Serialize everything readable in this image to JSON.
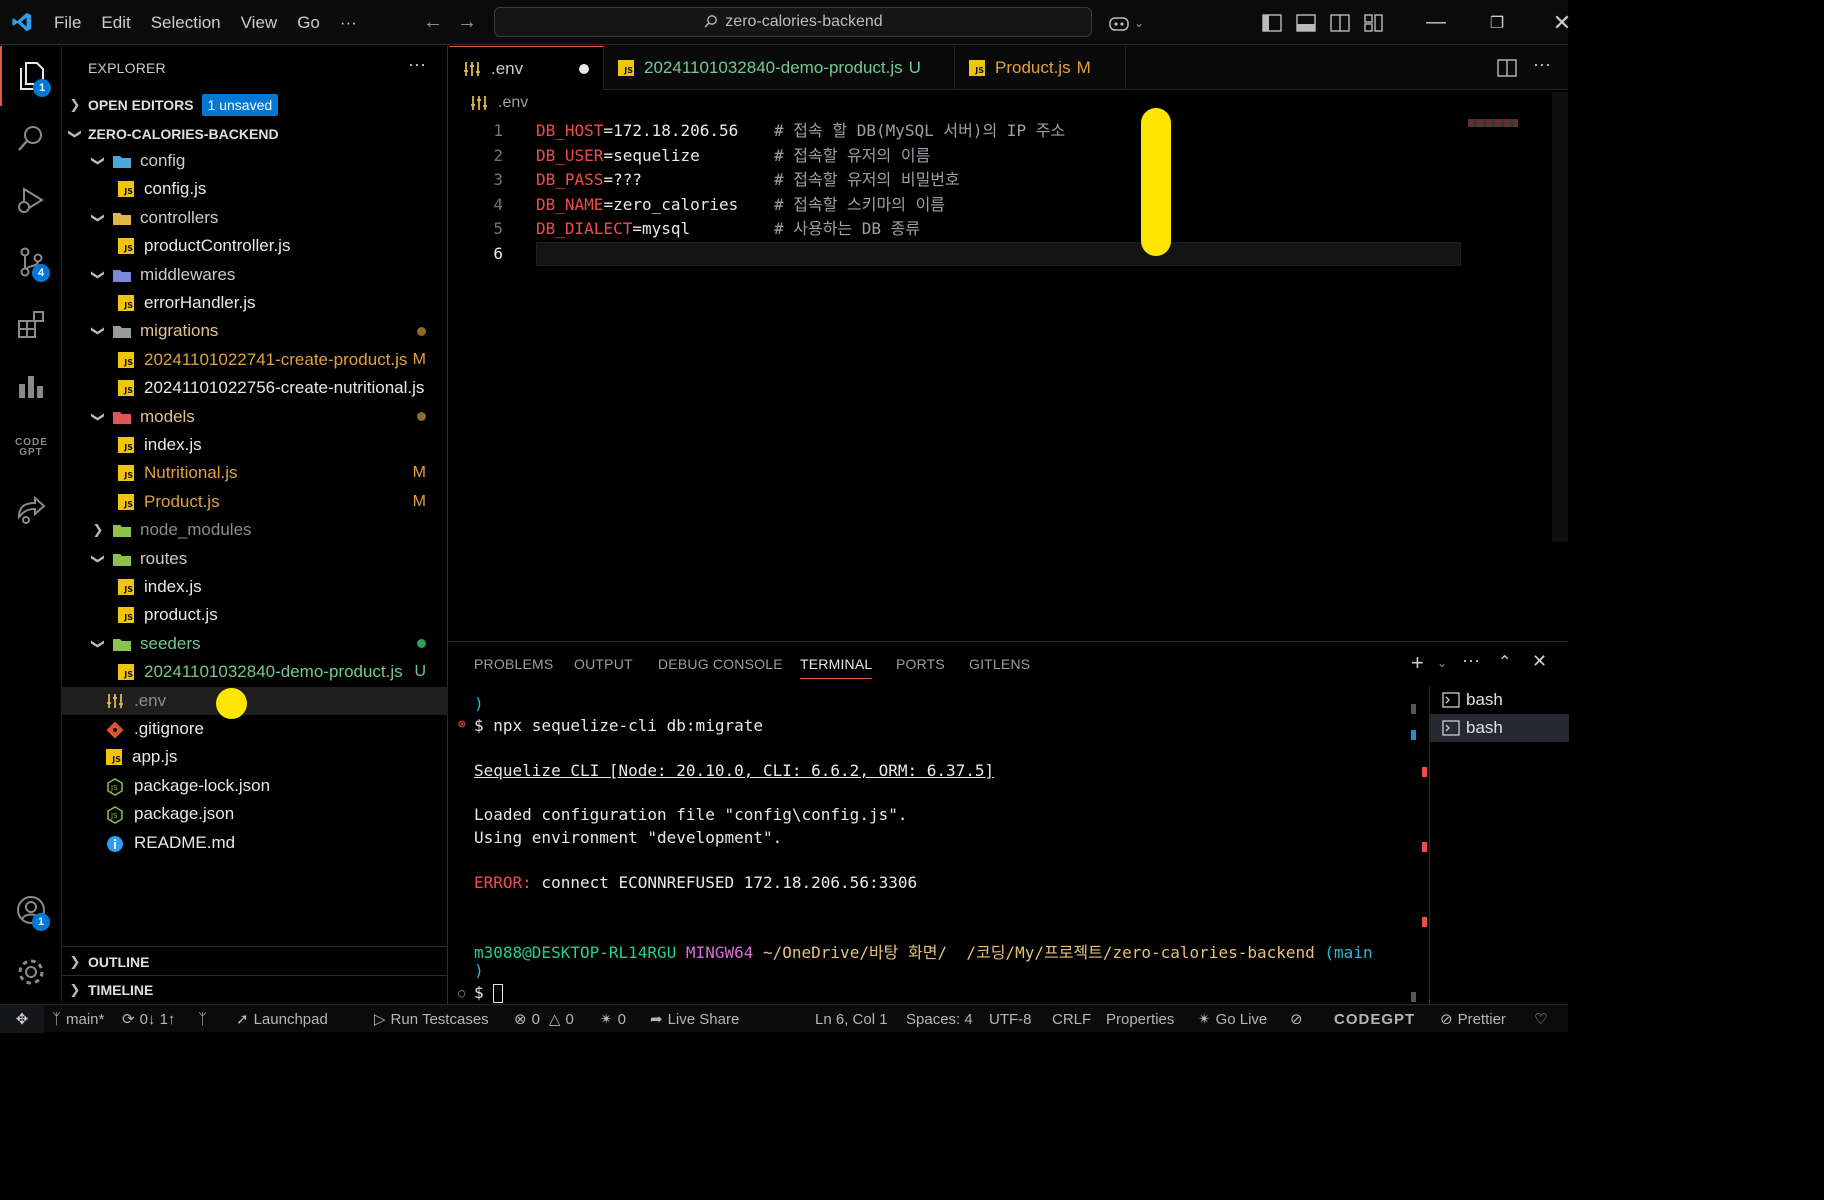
{
  "menu": [
    "File",
    "Edit",
    "Selection",
    "View",
    "Go",
    "···"
  ],
  "search": {
    "text": "zero-calories-backend"
  },
  "activity": {
    "explorer_badge": "1",
    "scm_badge": "4",
    "accounts_badge": "1",
    "codegpt_label": "CODE GPT"
  },
  "explorer": {
    "title": "EXPLORER",
    "open_editors": "OPEN EDITORS",
    "unsaved_badge": "1 unsaved",
    "root": "ZERO-CALORIES-BACKEND",
    "outline": "OUTLINE",
    "timeline": "TIMELINE",
    "tree": [
      {
        "name": "config",
        "kind": "folder",
        "color": "#cccccc"
      },
      {
        "name": "config.js",
        "kind": "js",
        "color": "#e8e8e8"
      },
      {
        "name": "controllers",
        "kind": "folder",
        "color": "#cccccc"
      },
      {
        "name": "productController.js",
        "kind": "js",
        "color": "#e8e8e8"
      },
      {
        "name": "middlewares",
        "kind": "folder",
        "color": "#cccccc"
      },
      {
        "name": "errorHandler.js",
        "kind": "js",
        "color": "#e8e8e8"
      },
      {
        "name": "migrations",
        "kind": "folder",
        "color": "#e2c08d"
      },
      {
        "name": "20241101022741-create-product.js",
        "kind": "js",
        "color": "#e2a13a",
        "status": "M"
      },
      {
        "name": "20241101022756-create-nutritional.js",
        "kind": "js",
        "color": "#e8e8e8"
      },
      {
        "name": "models",
        "kind": "folder",
        "color": "#e2c08d"
      },
      {
        "name": "index.js",
        "kind": "js",
        "color": "#e8e8e8"
      },
      {
        "name": "Nutritional.js",
        "kind": "js",
        "color": "#e2a13a",
        "status": "M"
      },
      {
        "name": "Product.js",
        "kind": "js",
        "color": "#e2a13a",
        "status": "M"
      },
      {
        "name": "node_modules",
        "kind": "folder",
        "color": "#8c8c8c"
      },
      {
        "name": "routes",
        "kind": "folder",
        "color": "#cccccc"
      },
      {
        "name": "index.js",
        "kind": "js",
        "color": "#e8e8e8"
      },
      {
        "name": "product.js",
        "kind": "js",
        "color": "#e8e8e8"
      },
      {
        "name": "seeders",
        "kind": "folder",
        "color": "#73c991"
      },
      {
        "name": "20241101032840-demo-product.js",
        "kind": "js",
        "color": "#73c991",
        "status": "U"
      },
      {
        "name": ".env",
        "kind": "env",
        "color": "#8c8c8c"
      },
      {
        "name": ".gitignore",
        "kind": "git",
        "color": "#e8e8e8"
      },
      {
        "name": "app.js",
        "kind": "js",
        "color": "#e8e8e8"
      },
      {
        "name": "package-lock.json",
        "kind": "json",
        "color": "#e8e8e8"
      },
      {
        "name": "package.json",
        "kind": "json",
        "color": "#e8e8e8"
      },
      {
        "name": "README.md",
        "kind": "info",
        "color": "#e8e8e8"
      }
    ]
  },
  "tabs": [
    {
      "label": ".env",
      "status": "",
      "color": "#8c8c8c"
    },
    {
      "label": "20241101032840-demo-product.js",
      "status": "U",
      "color": "#73c991"
    },
    {
      "label": "Product.js",
      "status": "M",
      "color": "#e2a13a"
    }
  ],
  "breadcrumb": ".env",
  "code": [
    {
      "n": "1",
      "key": "DB_HOST",
      "val": "172.18.206.56",
      "comment": "# 접속 할 DB(MySQL 서버)의 IP 주소"
    },
    {
      "n": "2",
      "key": "DB_USER",
      "val": "sequelize",
      "comment": "# 접속할 유저의 이름"
    },
    {
      "n": "3",
      "key": "DB_PASS",
      "val": "???",
      "comment": "# 접속할 유저의 비밀번호"
    },
    {
      "n": "4",
      "key": "DB_NAME",
      "val": "zero_calories",
      "comment": "# 접속할 스키마의 이름"
    },
    {
      "n": "5",
      "key": "DB_DIALECT",
      "val": "mysql",
      "comment": "# 사용하는 DB 종류"
    },
    {
      "n": "6",
      "key": "",
      "val": "",
      "comment": ""
    }
  ],
  "panel": {
    "tabs": [
      "PROBLEMS",
      "OUTPUT",
      "DEBUG CONSOLE",
      "TERMINAL",
      "PORTS",
      "GITLENS"
    ],
    "terminals": [
      "bash",
      "bash"
    ],
    "lines": {
      "l1": ")",
      "l2_prompt": "$ ",
      "l2_cmd": "npx sequelize-cli db:migrate",
      "l3": "Sequelize CLI [Node: 20.10.0, CLI: 6.6.2, ORM: 6.37.5]",
      "l4": "Loaded configuration file \"config\\config.js\".",
      "l5": "Using environment \"development\".",
      "l6_label": "ERROR:",
      "l6_text": " connect ECONNREFUSED 172.18.206.56:3306",
      "l7_user": "m3088@DESKTOP-RL14RGU",
      "l7_sys": " MINGW64",
      "l7_path": " ~/OneDrive/바탕 화면/  /코딩/My/프로젝트/zero-calories-backend",
      "l7_branch": " (main",
      "l8": ")",
      "l9_prompt": "$ "
    }
  },
  "status": {
    "branch": "main*",
    "sync": "0↓ 1↑",
    "launchpad": "Launchpad",
    "testcases": "Run Testcases",
    "errors": "0",
    "warnings": "0",
    "ports": "0",
    "liveshare": "Live Share",
    "position": "Ln 6, Col 1",
    "spaces": "Spaces: 4",
    "encoding": "UTF-8",
    "eol": "CRLF",
    "language": "Properties",
    "golive": "Go Live",
    "codegpt": "CODEGPT",
    "prettier": "Prettier"
  },
  "colors": {
    "accent": "#0078d4",
    "highlight": "#ffe600",
    "tab_active_border": "#e05a3a"
  }
}
